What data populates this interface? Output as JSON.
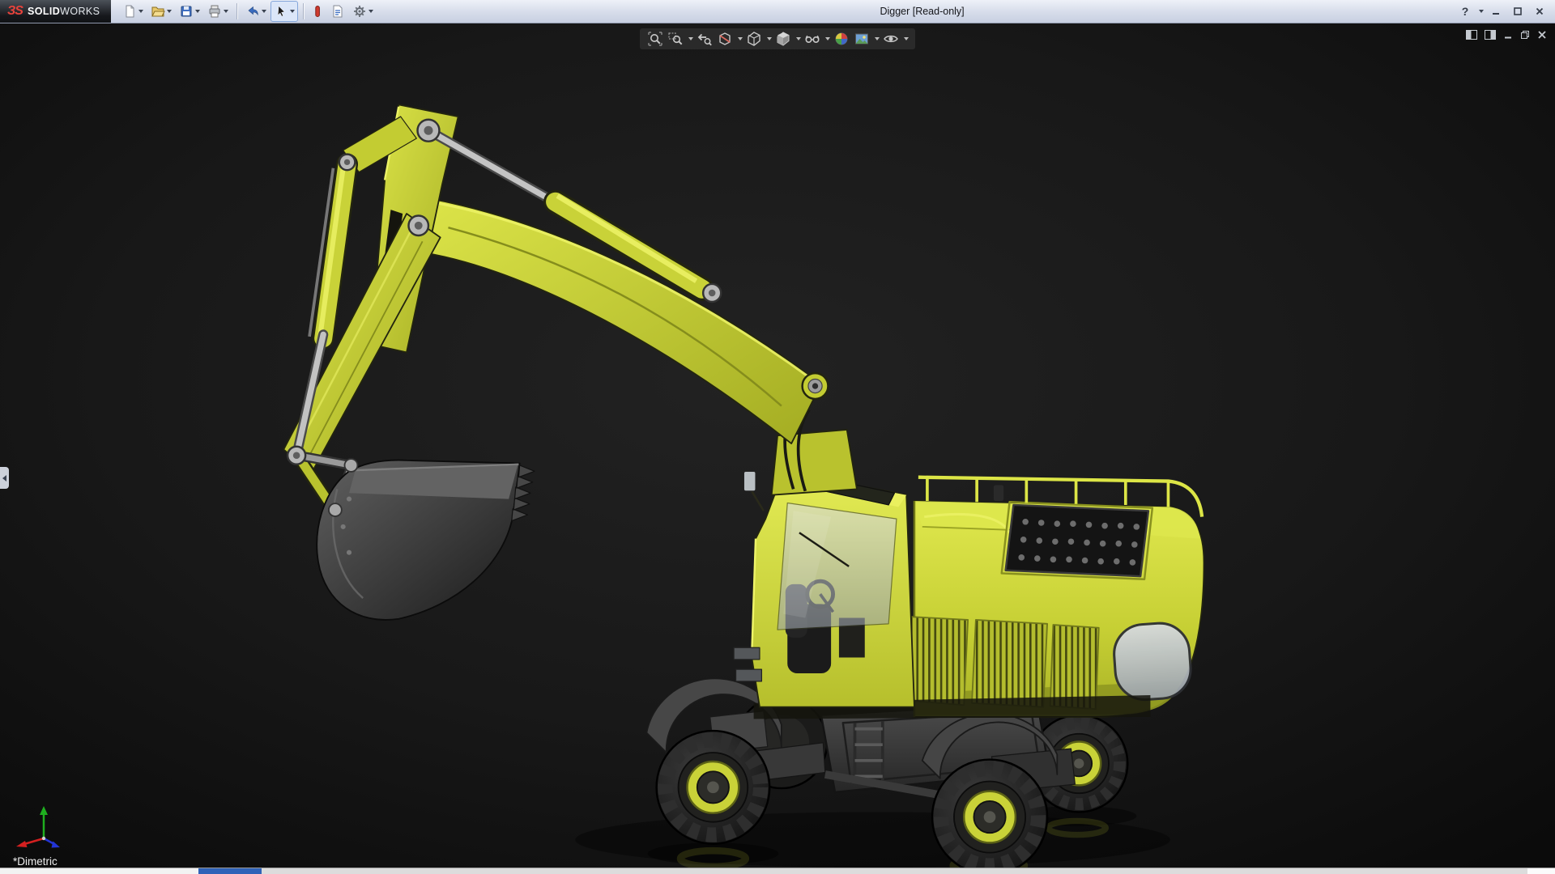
{
  "window": {
    "title": "Digger [Read-only]"
  },
  "brand": {
    "mark": "ЗS",
    "name_bold": "SOLID",
    "name_light": "WORKS"
  },
  "titlebar": {
    "quick_access": [
      {
        "name": "new-document",
        "dropdown": true
      },
      {
        "name": "open",
        "dropdown": true
      },
      {
        "name": "save",
        "dropdown": true
      },
      {
        "name": "print",
        "dropdown": true
      },
      {
        "name": "undo",
        "dropdown": true
      },
      {
        "name": "select",
        "dropdown": true
      },
      {
        "name": "rebuild",
        "dropdown": false
      },
      {
        "name": "file-properties",
        "dropdown": false
      },
      {
        "name": "options",
        "dropdown": true
      }
    ],
    "help_label": "?",
    "window_controls": [
      "minimize",
      "maximize",
      "close"
    ]
  },
  "viewport": {
    "heads_up_toolbar": [
      {
        "name": "zoom-to-fit",
        "dropdown": false
      },
      {
        "name": "zoom-to-area",
        "dropdown": true
      },
      {
        "name": "previous-view",
        "dropdown": false
      },
      {
        "name": "section-view",
        "dropdown": true
      },
      {
        "name": "view-orientation",
        "dropdown": true
      },
      {
        "name": "display-style",
        "dropdown": true
      },
      {
        "name": "hide-show-items",
        "dropdown": true
      },
      {
        "name": "edit-appearance",
        "dropdown": false
      },
      {
        "name": "apply-scene",
        "dropdown": true
      },
      {
        "name": "view-settings",
        "dropdown": true
      }
    ],
    "doc_controls": [
      "pane-left",
      "pane-right",
      "minimize-doc",
      "restore-doc",
      "close-doc"
    ],
    "orientation_label": "*Dimetric",
    "model_name": "Digger"
  },
  "colors": {
    "machine_yellow": "#c9d238",
    "viewport_background": "#141414",
    "titlebar": "#d9e0ec",
    "taskbar_blue": "#2f62b8"
  }
}
